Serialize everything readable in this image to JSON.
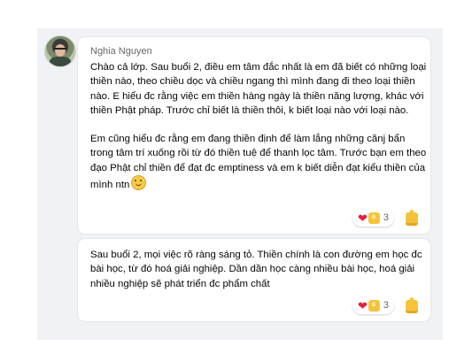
{
  "comment1": {
    "author": "Nghia Nguyen",
    "paragraph1": "Chào cả lớp. Sau buổi 2, điều em tâm đắc nhất là em đã biết có những loại thiền nào, theo chiều dọc và chiều ngang thì mình đang đi theo loại thiền nào. E hiểu đc rằng việc em thiền hàng ngày là thiền năng lượng, khác với thiền Phật pháp. Trước chỉ biết là thiền thôi, k biết loại nào với loại nào.",
    "paragraph2": "Em cũng hiểu đc rằng em đang thiền định để làm lắng những cănj bẩn trong tâm trí xuống rồi từ đó thiền tuệ để thanh lọc tâm.  Trước bạn em theo đạo Phật chỉ thiền để đạt đc emptiness và em k biết diễn đạt kiểu thiền của mình ntn",
    "trailing_emoji": "smiling-face-emoji",
    "reactions": {
      "icons": [
        "heart",
        "like"
      ],
      "count": "3"
    }
  },
  "comment2": {
    "text": "Sau buổi 2, mọi việc rõ ràng sáng tỏ. Thiền chính là con đường em học đc bài học, từ đó hoá giải nghiệp. Dần dần học càng nhiều bài học, hoá giải nhiều nghiệp sẽ phát triển đc phẩm chất",
    "reactions": {
      "icons": [
        "heart",
        "like"
      ],
      "count": "3"
    }
  },
  "colors": {
    "thread_bg": "#f0f2f5",
    "card_bg": "#ffffff",
    "author_text": "#65676b",
    "heart": "#e41e3f",
    "like": "#f5c33b"
  }
}
